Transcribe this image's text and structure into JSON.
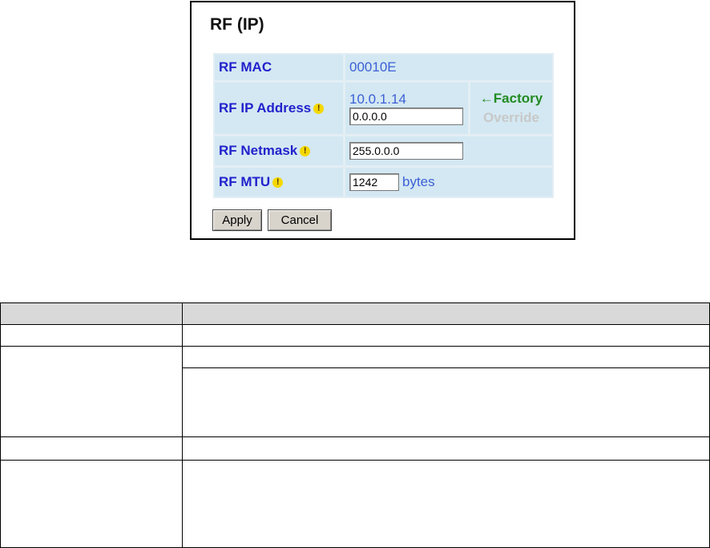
{
  "panel": {
    "title": "RF (IP)",
    "rows": {
      "mac": {
        "label": "RF MAC",
        "value": "00010E"
      },
      "ip": {
        "label": "RF IP Address",
        "factory_value": "10.0.1.14",
        "input_value": "0.0.0.0",
        "factory_link": "←Factory",
        "override_label": "Override"
      },
      "netmask": {
        "label": "RF Netmask",
        "input_value": "255.0.0.0"
      },
      "mtu": {
        "label": "RF MTU",
        "input_value": "1242",
        "unit": "bytes"
      }
    },
    "warning_glyph": "!",
    "apply_label": "Apply",
    "cancel_label": "Cancel"
  },
  "doc_table": {
    "headers": [
      "",
      ""
    ],
    "rows": [
      [
        "",
        ""
      ],
      [
        "",
        ""
      ],
      [
        "",
        ""
      ],
      [
        "",
        ""
      ],
      [
        "",
        ""
      ]
    ]
  },
  "colors": {
    "label_blue": "#2222cc",
    "value_blue": "#3d5fd6",
    "factory_green": "#228b22",
    "override_gray": "#c8c8c8",
    "form_bg": "#d3e8f2",
    "header_gray": "#d9d9d9"
  }
}
